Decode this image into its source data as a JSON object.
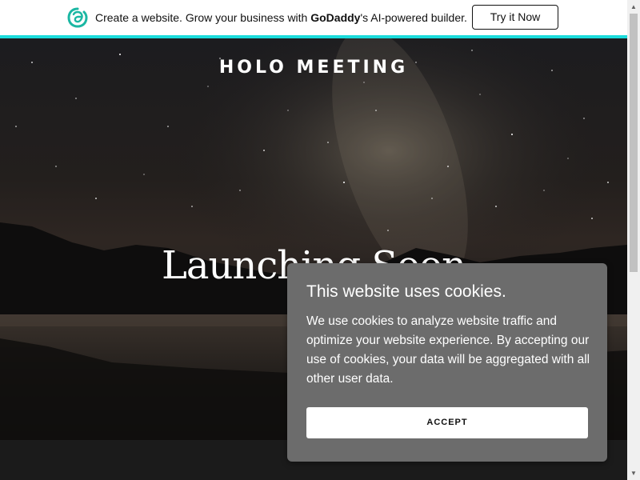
{
  "promo_banner": {
    "text_before": "Create a website. Grow your business with ",
    "brand": "GoDaddy",
    "text_after": "'s AI-powered builder.",
    "cta_label": "Try it Now",
    "accent_color": "#1bdbdb",
    "logo_icon": "godaddy-logo-icon"
  },
  "hero": {
    "site_title": "HOLO MEETING",
    "heading": "Launching Soon"
  },
  "cookie_dialog": {
    "title": "This website uses cookies.",
    "body": "We use cookies to analyze website traffic and optimize your website experience. By accepting our use of cookies, your data will be aggregated with all other user data.",
    "accept_label": "ACCEPT"
  },
  "scrollbar": {
    "up_icon": "scroll-up-arrow-icon",
    "down_icon": "scroll-down-arrow-icon"
  }
}
